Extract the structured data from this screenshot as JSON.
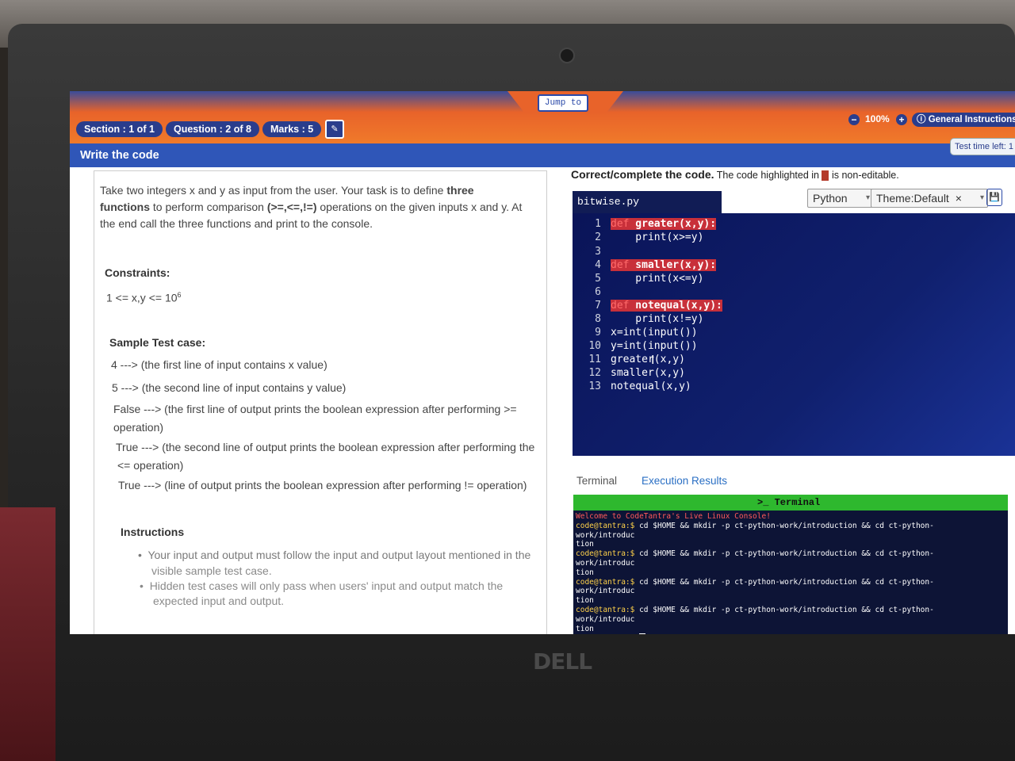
{
  "topbar": {
    "jump_label": "Jump to",
    "section": "Section : 1 of 1",
    "question": "Question : 2 of 8",
    "marks": "Marks : 5",
    "zoom": "100%",
    "zoom_minus": "−",
    "zoom_plus": "+",
    "general_instructions": "General Instructions",
    "test_time_left": "Test time left: 1"
  },
  "subbar": {
    "title": "Write the code"
  },
  "problem": {
    "intro_1": "Take two integers x and y as input from the user. Your task is to define ",
    "intro_bold_1": "three",
    "intro_bold_2": "functions",
    "intro_2": " to perform comparison ",
    "intro_bold_3": "(>=,<=,!=)",
    "intro_3": " operations on the given inputs x and y. At",
    "intro_4": "the end call the three functions and print to the console.",
    "constraints_heading": "Constraints:",
    "constraint_base": "1 <= x,y <= 10",
    "constraint_exp": "6",
    "sample_heading": "Sample Test case:",
    "sample_lines": [
      "4 ---> (the first line of input contains x value)",
      "5 ---> (the second line of input contains y value)",
      "False ---> (the first line of output prints the boolean expression after performing >=",
      "operation)",
      "True ---> (the second line of output prints the boolean expression after performing the",
      "<= operation)",
      "True ---> (line of output prints the boolean expression after performing != operation)"
    ],
    "instructions_heading": "Instructions",
    "instructions": [
      "Your input and output must follow the input and output layout mentioned in the",
      "visible sample test case.",
      "Hidden test cases will only pass when users' input and output match the",
      "expected input and output."
    ]
  },
  "editor": {
    "hint_bold": "Correct/complete the code.",
    "hint_text_1": " The code highlighted in ",
    "hint_text_2": " is non-editable.",
    "filename": "bitwise.py",
    "language": "Python",
    "theme": "Theme:Default",
    "theme_clear": "×",
    "dropdown_arrow": "▾",
    "lines": [
      {
        "n": "1",
        "kw": "def",
        "fn": " greater(x,y):",
        "rest": ""
      },
      {
        "n": "2",
        "kw": "",
        "fn": "",
        "rest": "    print(x>=y)"
      },
      {
        "n": "3",
        "kw": "",
        "fn": "",
        "rest": ""
      },
      {
        "n": "4",
        "kw": "def",
        "fn": " smaller(x,y):",
        "rest": ""
      },
      {
        "n": "5",
        "kw": "",
        "fn": "",
        "rest": "    print(x<=y)"
      },
      {
        "n": "6",
        "kw": "",
        "fn": "",
        "rest": ""
      },
      {
        "n": "7",
        "kw": "def",
        "fn": " notequal(x,y):",
        "rest": ""
      },
      {
        "n": "8",
        "kw": "",
        "fn": "",
        "rest": "    print(x!=y)"
      },
      {
        "n": "9",
        "kw": "",
        "fn": "",
        "rest": "x=int(input())"
      },
      {
        "n": "10",
        "kw": "",
        "fn": "",
        "rest": "y=int(input())"
      },
      {
        "n": "11",
        "kw": "",
        "fn": "",
        "rest": "greater(x,y)"
      },
      {
        "n": "12",
        "kw": "",
        "fn": "",
        "rest": "smaller(x,y)"
      },
      {
        "n": "13",
        "kw": "",
        "fn": "",
        "rest": "notequal(x,y)"
      }
    ]
  },
  "output_tabs": {
    "terminal": "Terminal",
    "execution": "Execution Results"
  },
  "terminal": {
    "title": "Terminal",
    "welcome": "Welcome to CodeTantra's Live Linux Console!",
    "prompt": "code@tantra:$",
    "command": " cd $HOME && mkdir -p ct-python-work/introduction && cd ct-python-work/introduc",
    "command_wrap": "tion"
  },
  "brand": {
    "logo": "DELL"
  }
}
